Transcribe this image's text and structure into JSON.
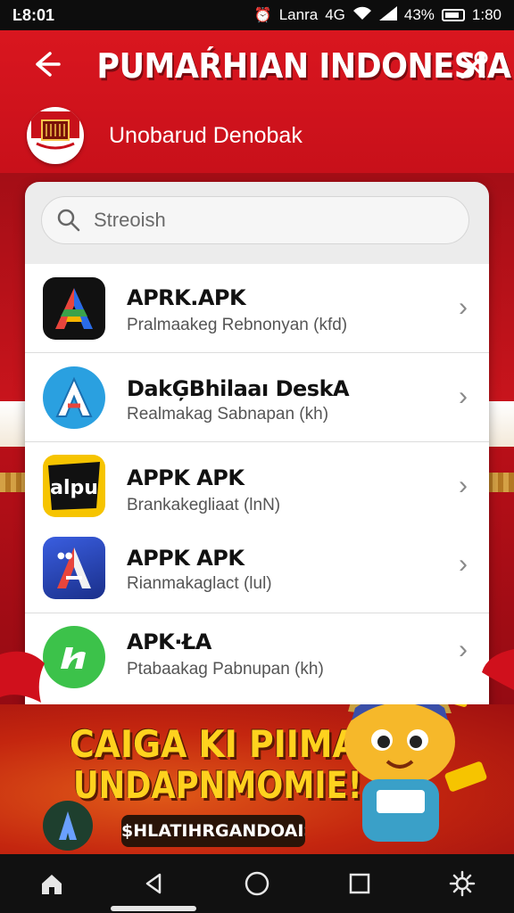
{
  "status_bar": {
    "time": "Ŀ8:01",
    "carrier": "Lanra",
    "network": "4G",
    "battery_percent": "43%",
    "clock": "1:80"
  },
  "header": {
    "title": "PUMAŔHIAN INDONESIA",
    "subtitle": "Unobarud Denobak",
    "back_icon": "back-arrow-icon",
    "tools_icon": "tools-icon"
  },
  "search": {
    "placeholder": "Streoish",
    "value": ""
  },
  "apps": [
    {
      "title": "APRK.APK",
      "subtitle": "Pralmaakeg Rebnonyan (kfd)",
      "icon": "apk-a-icon",
      "colors": [
        "#111111",
        "#e8453c",
        "#3aa24a",
        "#2a6be6",
        "#f6b400"
      ]
    },
    {
      "title": "DakĢBhilaaı DeskA",
      "subtitle": "Realmakag Sabnapan (kh)",
      "icon": "apk-blue-a-icon",
      "colors": [
        "#2aa0e0",
        "#ffffff",
        "#e8453c"
      ]
    },
    {
      "title": "APPK APK",
      "subtitle": "Brankakegliaat (lnN)",
      "icon": "alpu-icon",
      "colors": [
        "#f6c400",
        "#111111"
      ]
    },
    {
      "title": "APPK APK",
      "subtitle": "Rianmakaglact (lul)",
      "icon": "apk-gradient-a-icon",
      "colors": [
        "#2a4ec8",
        "#e8453c"
      ]
    },
    {
      "title": "APK·ŁA",
      "subtitle": "Ptabaakag Pabnupan (kh)",
      "icon": "green-n-icon",
      "colors": [
        "#3cc24a"
      ]
    }
  ],
  "promo": {
    "line1": "CAIGA KI PIIMA",
    "line2": "UNDAPNMOMIE!",
    "tag": "$HLATIHRGANDOAIS"
  },
  "nav": {
    "items": [
      "home-icon",
      "back-triangle-icon",
      "circle-home-icon",
      "recents-square-icon",
      "settings-gear-icon"
    ]
  }
}
